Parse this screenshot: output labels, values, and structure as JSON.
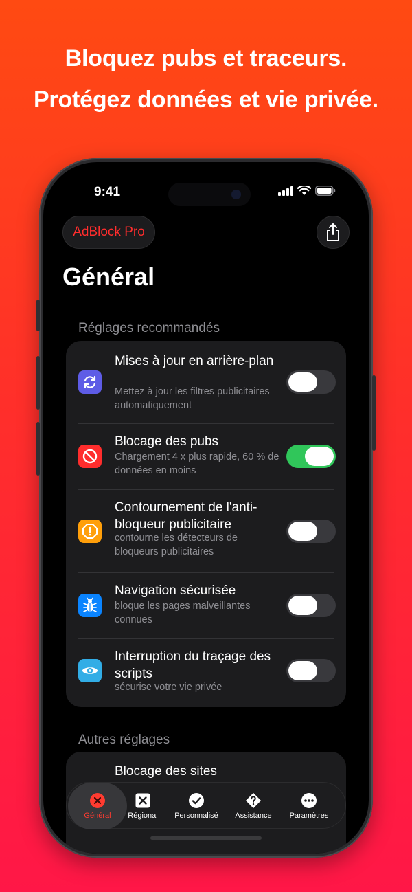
{
  "headline": {
    "line1": "Bloquez pubs et traceurs.",
    "line2": "Protégez données et vie privée."
  },
  "status_bar": {
    "time": "9:41",
    "icons": [
      "signal-icon",
      "wifi-icon",
      "battery-icon"
    ]
  },
  "header": {
    "brand": "AdBlock Pro",
    "share_icon": "share-icon",
    "title": "Général"
  },
  "recommended": {
    "section_title": "Réglages recommandés",
    "items": [
      {
        "title": "Mises à jour en arrière-plan",
        "subtitle": "Mettez à jour les filtres publicitaires automatiquement",
        "icon": "refresh-icon",
        "icon_color": "#5e5ce6",
        "enabled": false
      },
      {
        "title": "Blocage des pubs",
        "subtitle": "Chargement 4 x plus rapide, 60 % de données en moins",
        "icon": "block-icon",
        "icon_color": "#ff2d2d",
        "enabled": true
      },
      {
        "title": "Contournement de l'anti-bloqueur publicitaire",
        "subtitle": "contourne les détecteurs de bloqueurs publicitaires",
        "icon": "warning-icon",
        "icon_color": "#ff9f0a",
        "enabled": false
      },
      {
        "title": "Navigation sécurisée",
        "subtitle": "bloque les pages malveillantes connues",
        "icon": "bug-icon",
        "icon_color": "#0a84ff",
        "enabled": false
      },
      {
        "title": "Interruption du traçage des scripts",
        "subtitle": "sécurise votre vie privée",
        "icon": "eye-icon",
        "icon_color": "#32ade6",
        "enabled": false
      }
    ]
  },
  "other": {
    "section_title": "Autres réglages",
    "items": [
      {
        "title": "Blocage des sites"
      }
    ]
  },
  "tabs": [
    {
      "label": "Général",
      "icon": "close-circle-icon",
      "active": true
    },
    {
      "label": "Régional",
      "icon": "x-square-icon",
      "active": false
    },
    {
      "label": "Personnalisé",
      "icon": "check-circle-icon",
      "active": false
    },
    {
      "label": "Assistance",
      "icon": "question-diamond-icon",
      "active": false
    },
    {
      "label": "Paramètres",
      "icon": "more-circle-icon",
      "active": false
    }
  ],
  "colors": {
    "accent": "#ff3b30",
    "toggle_on": "#30c65a",
    "card": "#1c1c1e"
  }
}
